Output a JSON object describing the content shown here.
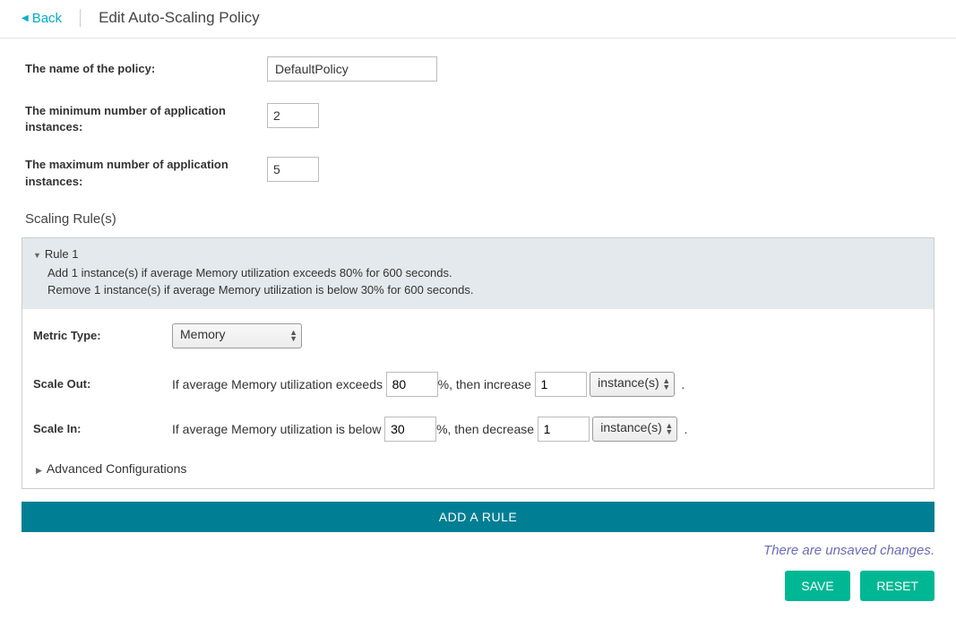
{
  "header": {
    "back_label": "Back",
    "page_title": "Edit Auto-Scaling Policy"
  },
  "form": {
    "policy_name_label": "The name of the policy:",
    "policy_name_value": "DefaultPolicy",
    "min_instances_label": "The minimum number of application instances:",
    "min_instances_value": "2",
    "max_instances_label": "The maximum number of application instances:",
    "max_instances_value": "5"
  },
  "scaling": {
    "section_title": "Scaling Rule(s)",
    "rule_title": "Rule 1",
    "rule_desc_out": "Add 1 instance(s) if average Memory utilization exceeds 80% for 600 seconds.",
    "rule_desc_in": "Remove 1 instance(s) if average Memory utilization is below 30% for 600 seconds.",
    "metric_type_label": "Metric Type:",
    "metric_type_value": "Memory",
    "scale_out_label": "Scale Out:",
    "scale_out_text_pre": "If average Memory utilization exceeds",
    "scale_out_threshold": "80",
    "scale_out_text_mid": "%, then increase",
    "scale_out_count": "1",
    "scale_in_label": "Scale In:",
    "scale_in_text_pre": "If average Memory utilization is below",
    "scale_in_threshold": "30",
    "scale_in_text_mid": "%, then decrease",
    "scale_in_count": "1",
    "instance_unit": "instance(s)",
    "period": ".",
    "advanced_label": "Advanced Configurations",
    "add_rule_label": "ADD A RULE"
  },
  "footer": {
    "unsaved_msg": "There are unsaved changes.",
    "save_label": "SAVE",
    "reset_label": "RESET"
  }
}
